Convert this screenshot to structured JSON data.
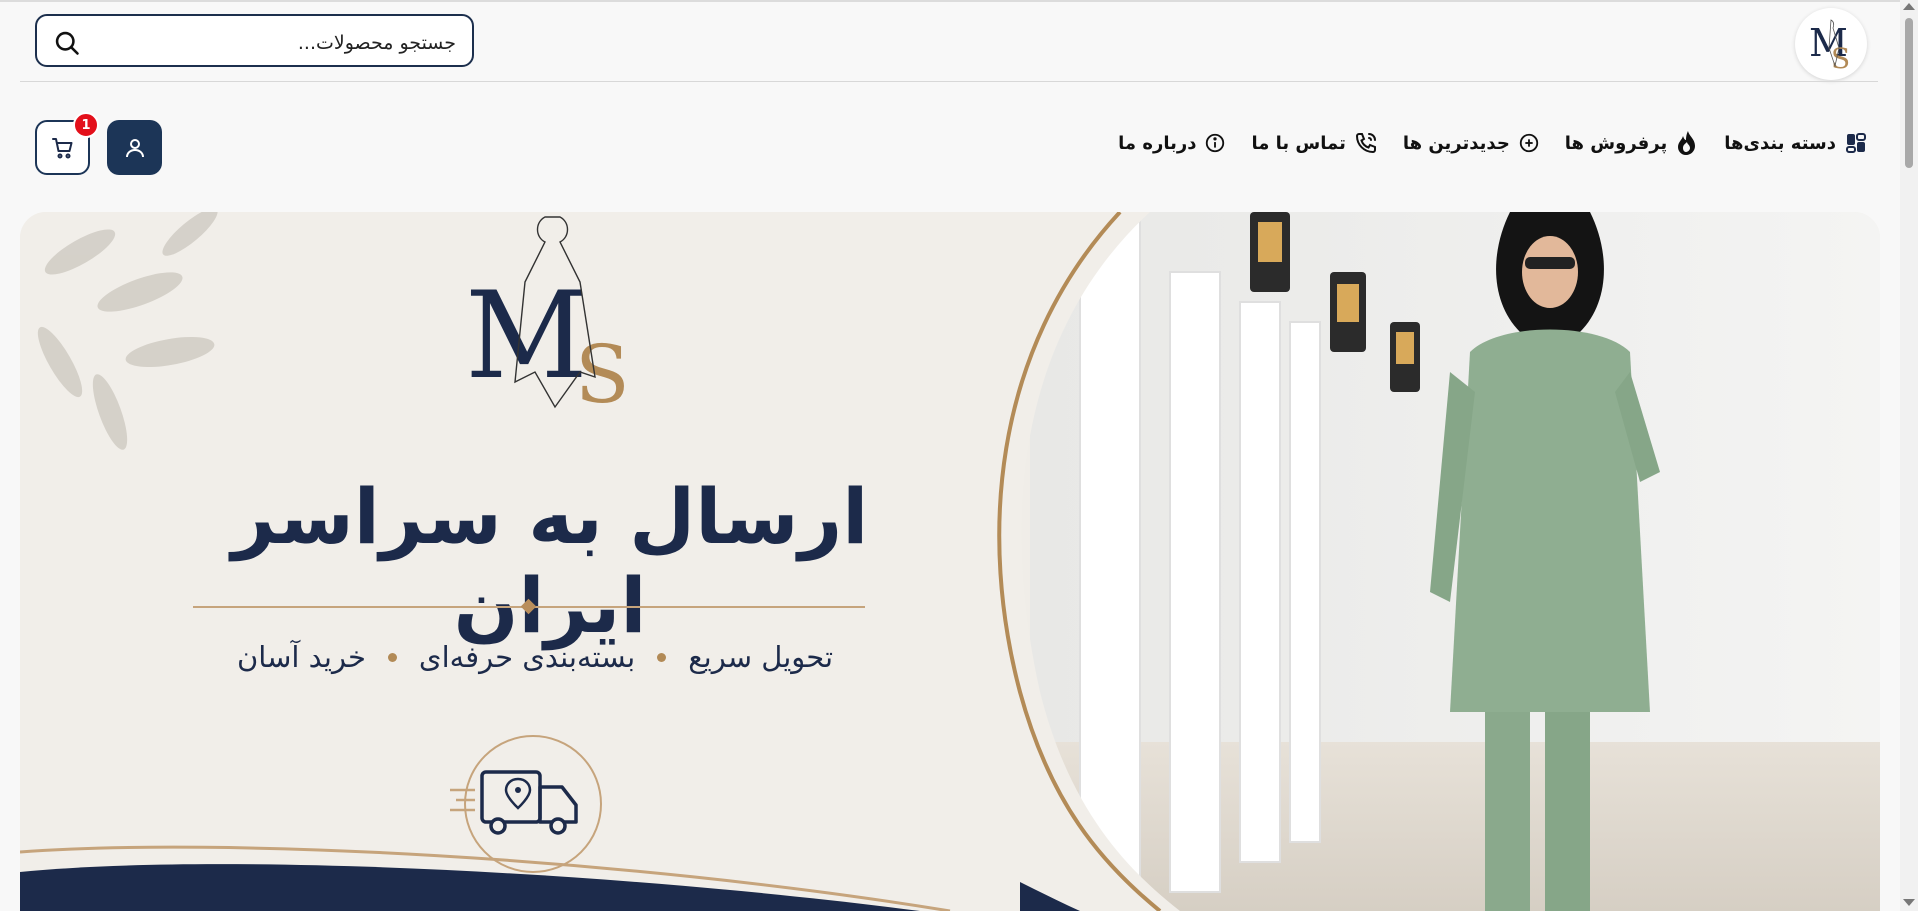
{
  "header": {
    "search_placeholder": "جستجو محصولات...",
    "logo_text_main": "M",
    "logo_text_secondary": "S",
    "cart_count": "1"
  },
  "nav": {
    "items": [
      {
        "label": "دسته بندی‌ها",
        "icon": "grid-icon"
      },
      {
        "label": "پرفروش ها",
        "icon": "flame-icon"
      },
      {
        "label": "جدیدترین ها",
        "icon": "plus-circle-icon"
      },
      {
        "label": "تماس با ما",
        "icon": "phone-icon"
      },
      {
        "label": "درباره ما",
        "icon": "info-icon"
      }
    ]
  },
  "banner": {
    "logo_main": "M",
    "logo_secondary": "S",
    "title": "ارسال به سراسر ایران",
    "features": [
      "تحویل سریع",
      "بسته‌بندی حرفه‌ای",
      "خرید آسان"
    ]
  },
  "colors": {
    "navy": "#1c2a4a",
    "gold": "#b28a56",
    "badge": "#e3101b",
    "green_outfit": "#8fae91"
  }
}
